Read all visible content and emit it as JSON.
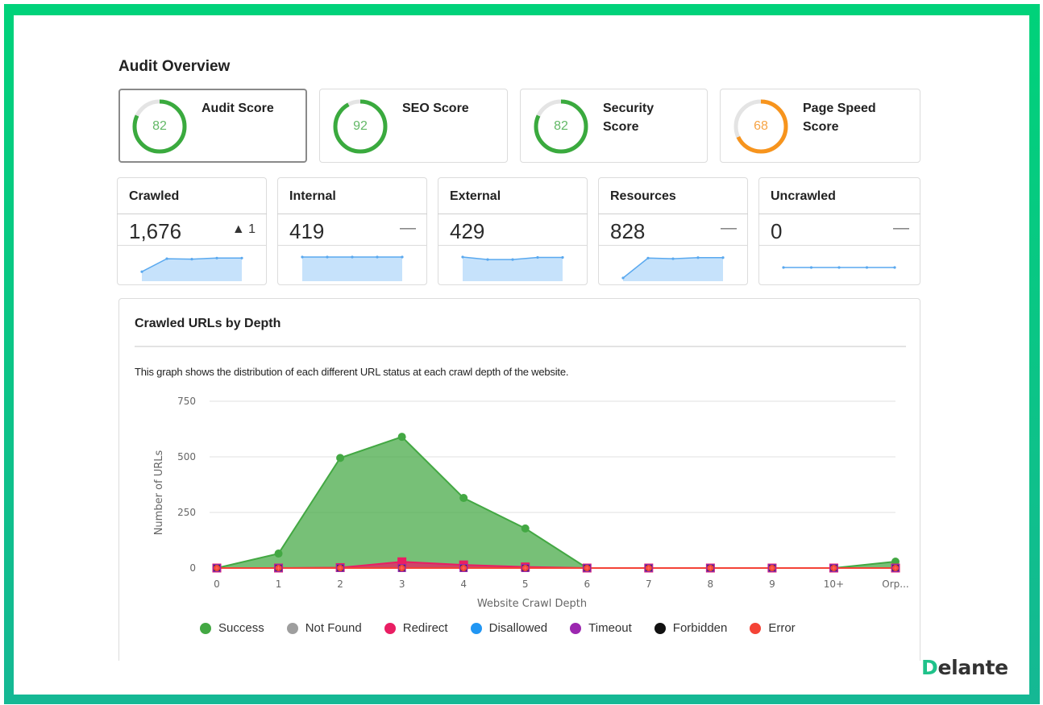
{
  "header": {
    "title": "Audit Overview"
  },
  "score_cards": [
    {
      "label": "Audit Score",
      "value": 82,
      "max": 100,
      "color": "#3aaa3e",
      "text_color": "#62b866",
      "selected": true
    },
    {
      "label": "SEO Score",
      "value": 92,
      "max": 100,
      "color": "#3aaa3e",
      "text_color": "#62b866",
      "selected": false
    },
    {
      "label": "Security Score",
      "value": 82,
      "max": 100,
      "color": "#3aaa3e",
      "text_color": "#62b866",
      "selected": false
    },
    {
      "label": "Page Speed Score",
      "value": 68,
      "max": 100,
      "color": "#f7941d",
      "text_color": "#f7a445",
      "selected": false
    }
  ],
  "stat_cards": [
    {
      "title": "Crawled",
      "value": "1,676",
      "change": "▲ 1",
      "change_type": "up",
      "trend": [
        0.3,
        0.92,
        0.9,
        0.95,
        0.95
      ],
      "trend_range": [
        0,
        1
      ]
    },
    {
      "title": "Internal",
      "value": "419",
      "change": "—",
      "change_type": "none",
      "trend": [
        1,
        1,
        1,
        1,
        1
      ],
      "trend_range": [
        0,
        1
      ]
    },
    {
      "title": "External",
      "value": "429",
      "change": "",
      "change_type": "none",
      "trend": [
        1,
        0.88,
        0.88,
        0.98,
        0.98
      ],
      "trend_range": [
        0,
        1
      ]
    },
    {
      "title": "Resources",
      "value": "828",
      "change": "—",
      "change_type": "none",
      "trend": [
        0.0,
        0.95,
        0.92,
        0.97,
        0.97
      ],
      "trend_range": [
        0,
        1
      ]
    },
    {
      "title": "Uncrawled",
      "value": "0",
      "change": "—",
      "change_type": "none",
      "trend": [
        0,
        0,
        0,
        0,
        0
      ],
      "trend_range": [
        0,
        0
      ],
      "flat": true
    }
  ],
  "chart_panel": {
    "title": "Crawled URLs by Depth",
    "description": "This graph shows the distribution of each different URL status at each crawl depth of the website."
  },
  "chart_data": {
    "type": "area",
    "title": "Crawled URLs by Depth",
    "xlabel": "Website Crawl Depth",
    "ylabel": "Number of URLs",
    "categories": [
      "0",
      "1",
      "2",
      "3",
      "4",
      "5",
      "6",
      "7",
      "8",
      "9",
      "10+",
      "Orp..."
    ],
    "ylim": [
      0,
      750
    ],
    "yticks": [
      0,
      250,
      500,
      750
    ],
    "grid": true,
    "legend_position": "bottom",
    "series": [
      {
        "name": "Success",
        "color": "#43a843",
        "values": [
          0,
          65,
          495,
          590,
          315,
          178,
          0,
          0,
          0,
          0,
          0,
          29
        ]
      },
      {
        "name": "Not Found",
        "color": "#9e9e9e",
        "values": [
          0,
          0,
          0,
          0,
          0,
          0,
          0,
          0,
          0,
          0,
          0,
          0
        ]
      },
      {
        "name": "Redirect",
        "color": "#e91e63",
        "values": [
          0,
          0,
          2,
          28,
          14,
          5,
          0,
          0,
          0,
          0,
          0,
          0
        ]
      },
      {
        "name": "Disallowed",
        "color": "#2196f3",
        "values": [
          0,
          0,
          0,
          0,
          0,
          0,
          0,
          0,
          0,
          0,
          0,
          0
        ]
      },
      {
        "name": "Timeout",
        "color": "#9c27b0",
        "values": [
          0,
          0,
          0,
          0,
          0,
          0,
          0,
          0,
          0,
          0,
          0,
          0
        ]
      },
      {
        "name": "Forbidden",
        "color": "#111111",
        "values": [
          0,
          0,
          0,
          0,
          0,
          0,
          0,
          0,
          0,
          0,
          0,
          0
        ]
      },
      {
        "name": "Error",
        "color": "#f44336",
        "values": [
          0,
          0,
          0,
          0,
          0,
          0,
          0,
          0,
          0,
          0,
          0,
          0
        ]
      }
    ]
  },
  "brand": {
    "first": "D",
    "rest": "elante"
  },
  "colors": {
    "frame_top": "#00d27a",
    "frame_bottom": "#15b894",
    "spark_line": "#5aa9ef",
    "spark_fill": "#c6e2fb"
  }
}
